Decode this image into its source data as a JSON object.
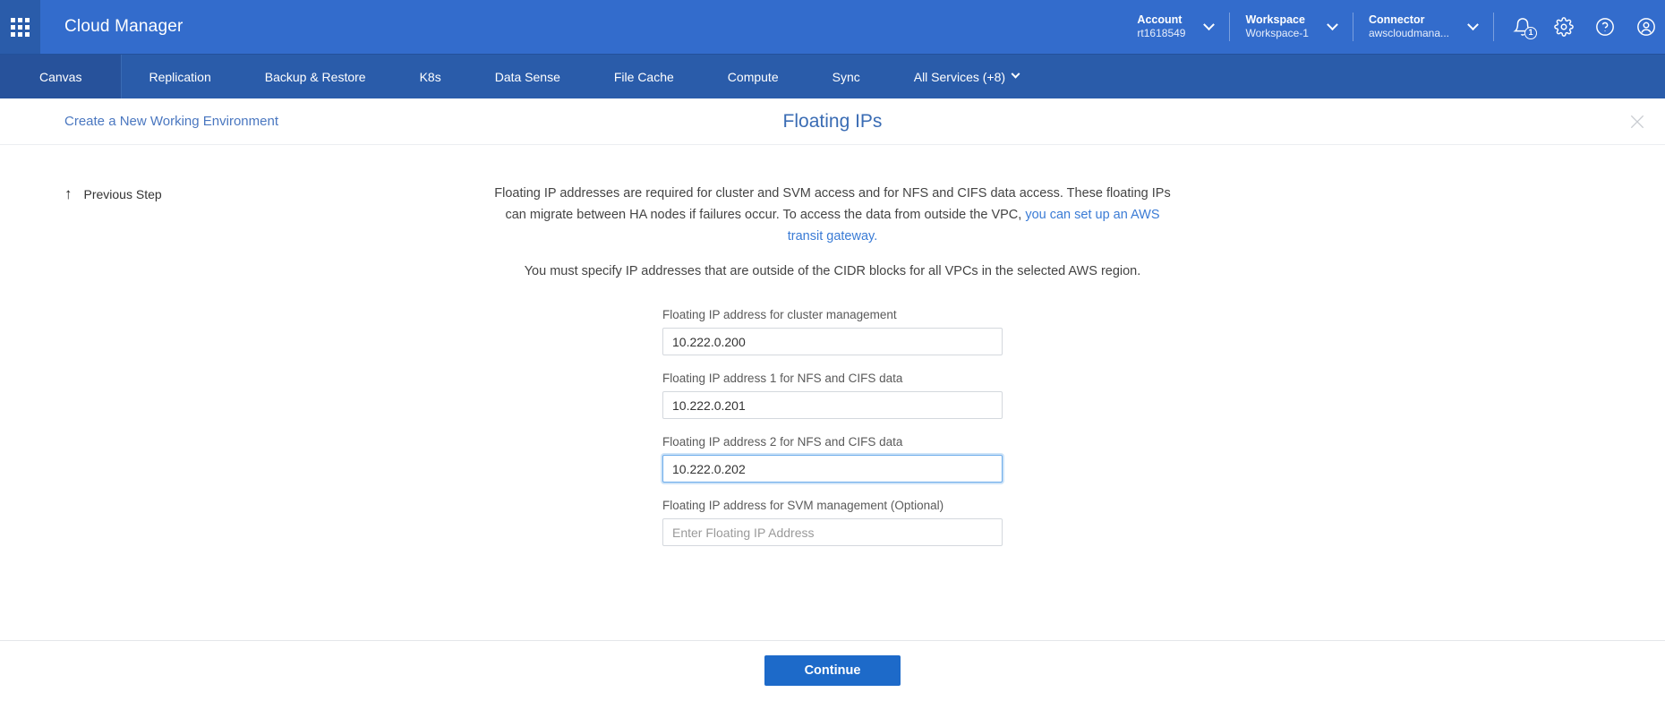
{
  "header": {
    "app_grid_icon": "apps-grid-icon",
    "brand": "Cloud Manager",
    "account": {
      "label": "Account",
      "value": "rt1618549"
    },
    "workspace": {
      "label": "Workspace",
      "value": "Workspace-1"
    },
    "connector": {
      "label": "Connector",
      "value": "awscloudmana..."
    },
    "notifications": {
      "icon": "bell-icon",
      "badge": "1"
    },
    "settings_icon": "gear-icon",
    "help_icon": "help-circle-icon",
    "user_icon": "user-avatar-icon",
    "brand_color": "#336ccc",
    "nav_color": "#2a5caa"
  },
  "nav": {
    "items": [
      {
        "label": "Canvas",
        "active": true
      },
      {
        "label": "Replication",
        "active": false
      },
      {
        "label": "Backup & Restore",
        "active": false
      },
      {
        "label": "K8s",
        "active": false
      },
      {
        "label": "Data Sense",
        "active": false
      },
      {
        "label": "File Cache",
        "active": false
      },
      {
        "label": "Compute",
        "active": false
      },
      {
        "label": "Sync",
        "active": false
      }
    ],
    "all_services": "All Services (+8)"
  },
  "page": {
    "breadcrumb": "Create a New Working Environment",
    "title": "Floating IPs",
    "close_icon": "close-icon",
    "previous_step": "Previous Step",
    "previous_step_icon": "arrow-up-icon"
  },
  "description": {
    "para1_part1": "Floating IP addresses are required for cluster and SVM access and for NFS and CIFS data access. These floating IPs can migrate between HA nodes if failures occur. To access the data from outside the VPC, ",
    "para1_link": "you can set up an AWS transit gateway.",
    "para2": "You must specify IP addresses that are outside of the CIDR blocks for all VPCs in the selected AWS region.",
    "link_color": "#3a7bd5"
  },
  "form": {
    "fields": [
      {
        "label": "Floating IP address for cluster management",
        "value": "10.222.0.200",
        "placeholder": "Enter Floating IP Address",
        "focused": false
      },
      {
        "label": "Floating IP address 1 for NFS and CIFS data",
        "value": "10.222.0.201",
        "placeholder": "Enter Floating IP Address",
        "focused": false
      },
      {
        "label": "Floating IP address 2 for NFS and CIFS data",
        "value": "10.222.0.202",
        "placeholder": "Enter Floating IP Address",
        "focused": true
      },
      {
        "label": "Floating IP address for SVM management (Optional)",
        "value": "",
        "placeholder": "Enter Floating IP Address",
        "focused": false
      }
    ]
  },
  "footer": {
    "continue_label": "Continue",
    "continue_color": "#1d6ac9"
  }
}
